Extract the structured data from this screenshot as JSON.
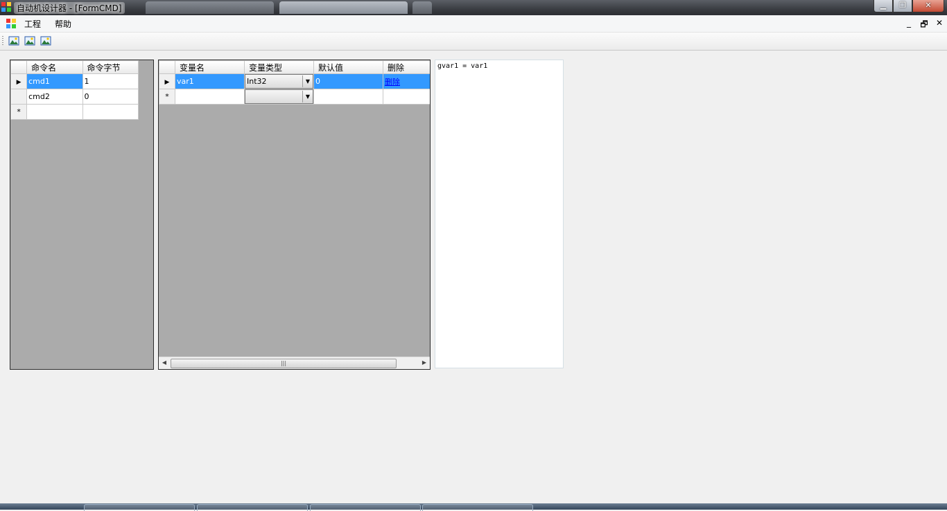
{
  "window": {
    "title": "自动机设计器 - [FormCMD]"
  },
  "menu": {
    "items": [
      "工程",
      "帮助"
    ]
  },
  "mdi_controls": {
    "minimize": "_",
    "restore": "🗗",
    "close": "✕"
  },
  "toolbar": {
    "buttons": [
      "image-icon",
      "image-icon",
      "image-icon"
    ]
  },
  "cmd_grid": {
    "headers": [
      "命令名",
      "命令字节"
    ],
    "rows": [
      {
        "name": "cmd1",
        "byte": "1",
        "selected": true
      },
      {
        "name": "cmd2",
        "byte": "0",
        "selected": false
      }
    ],
    "new_row_marker": "*"
  },
  "var_grid": {
    "headers": [
      "变量名",
      "变量类型",
      "默认值",
      "删除"
    ],
    "rows": [
      {
        "name": "var1",
        "type": "Int32",
        "default": "0",
        "delete": "删除",
        "selected": true
      }
    ],
    "new_row_marker": "*",
    "new_row_type": ""
  },
  "code_text": "gvar1 = var1",
  "colors": {
    "selection": "#3399ff",
    "grid_bg": "#ababab",
    "link": "#0000ff"
  }
}
